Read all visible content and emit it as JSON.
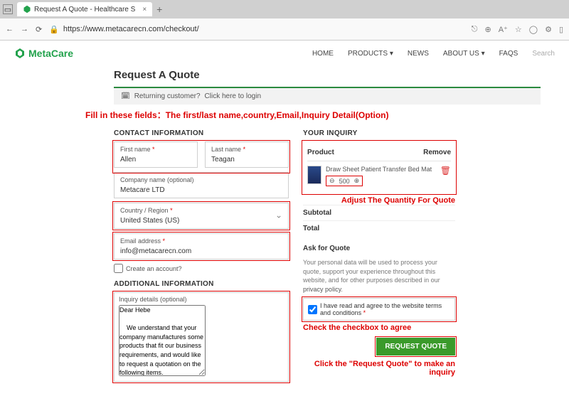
{
  "browser": {
    "tab_title": "Request A Quote - Healthcare S",
    "url": "https://www.metacarecn.com/checkout/"
  },
  "nav": {
    "logo": "MetaCare",
    "items": [
      "HOME",
      "PRODUCTS ▾",
      "NEWS",
      "ABOUT US ▾",
      "FAQS",
      "Search"
    ]
  },
  "page": {
    "title": "Request A Quote",
    "returning": "Returning customer?",
    "returning_link": "Click here to login"
  },
  "annotations": {
    "fill_fields": "Fill in these fields：The first/last name,country,Email,Inquiry Detail(Option)",
    "adjust_qty": "Adjust The Quantity For Quote",
    "check_agree": "Check the checkbox to agree",
    "click_request": "Click the \"Request Quote\" to make an inquiry"
  },
  "contact": {
    "heading": "CONTACT INFORMATION",
    "first_label": "First name",
    "first_value": "Allen",
    "last_label": "Last name",
    "last_value": "Teagan",
    "company_label": "Company name (optional)",
    "company_value": "Metacare LTD",
    "country_label": "Country / Region",
    "country_value": "United States (US)",
    "email_label": "Email address",
    "email_value": "info@metacarecn.com",
    "create_account": "Create an account?"
  },
  "additional": {
    "heading": "ADDITIONAL INFORMATION",
    "details_label": "Inquiry details (optional)",
    "details_value": "Dear Hebe\n\n    We understand that your company manufactures some products that fit our business requirements, and would like to request a quotation on the following items.\nPlease offer us the details of its quality, unit price,date of shipment, payment, and if it is possible send us sample. We also want to know your lowest price CIF(port of destination).our phone number is 13XXXXXXXX\n\nWe are looking forward to your earliest reply."
  },
  "inquiry": {
    "heading": "YOUR INQUIRY",
    "col_product": "Product",
    "col_remove": "Remove",
    "product_name": "Draw Sheet Patient Transfer Bed Mat",
    "qty": "500",
    "subtotal_label": "Subtotal",
    "total_label": "Total"
  },
  "ask": {
    "heading": "Ask for Quote",
    "privacy_text": "Your personal data will be used to process your quote, support your experience throughout this website, and for other purposes described in our ",
    "privacy_link": "privacy policy",
    "agree_text": "I have read and agree to the website ",
    "agree_link": "terms and conditions",
    "button": "REQUEST QUOTE"
  }
}
